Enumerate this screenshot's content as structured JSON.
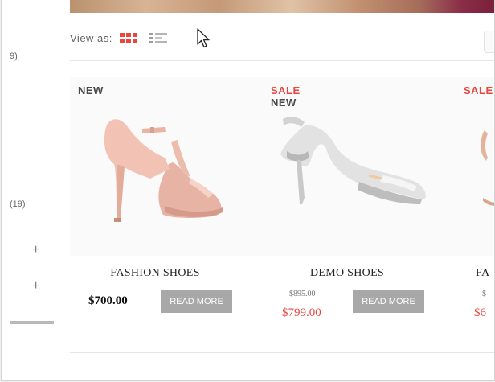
{
  "toolbar": {
    "view_as_label": "View as:",
    "grid_icon": "grid-view-icon",
    "list_icon": "list-view-icon",
    "active_color": "#e8463f"
  },
  "sidebar": {
    "counts": [
      "9)",
      "(19)"
    ],
    "expand_symbols": [
      "+",
      "+"
    ]
  },
  "products": [
    {
      "badges": [
        "NEW"
      ],
      "name": "FASHION SHOES",
      "price": "$700.00",
      "button_label": "READ MORE"
    },
    {
      "badges": [
        "SALE",
        "NEW"
      ],
      "name": "DEMO SHOES",
      "old_price": "$895.00",
      "price": "$799.00",
      "button_label": "READ MORE"
    },
    {
      "badges": [
        "SALE"
      ],
      "name": "FA",
      "old_price": "$",
      "price": "$6"
    }
  ],
  "colors": {
    "sale_red": "#e8463f",
    "button_gray": "#a8a8a8"
  }
}
